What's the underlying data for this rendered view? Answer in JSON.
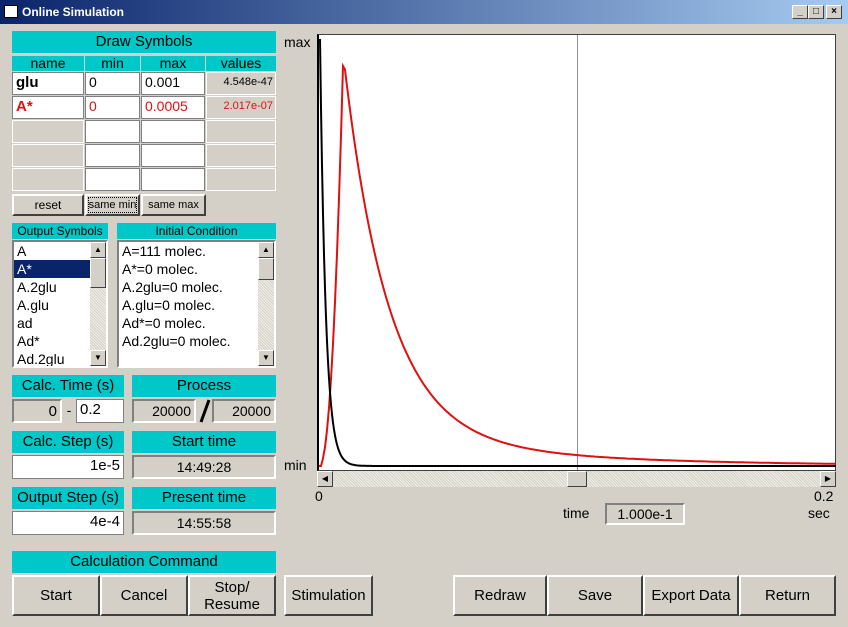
{
  "window": {
    "title": "Online Simulation",
    "buttons": [
      "_",
      "□",
      "×"
    ]
  },
  "draw_symbols": {
    "header": "Draw Symbols",
    "columns": [
      "name",
      "min",
      "max",
      "values"
    ],
    "rows": [
      {
        "name": "glu",
        "min": "0",
        "max": "0.001",
        "value": "4.548e-47",
        "color": "#000000"
      },
      {
        "name": "A*",
        "min": "0",
        "max": "0.0005",
        "value": "2.017e-07",
        "color": "#dd1111"
      },
      {
        "name": "",
        "min": "",
        "max": "",
        "value": ""
      },
      {
        "name": "",
        "min": "",
        "max": "",
        "value": ""
      },
      {
        "name": "",
        "min": "",
        "max": "",
        "value": ""
      }
    ],
    "reset": "reset",
    "same_min": "same min",
    "same_max": "same max"
  },
  "output_symbols": {
    "header": "Output Symbols",
    "items": [
      "A",
      "A*",
      "A.2glu",
      "A.glu",
      "ad",
      "Ad*",
      "Ad.2glu"
    ],
    "selected_index": 1
  },
  "initial_condition": {
    "header": "Initial Condition",
    "items": [
      "A=111 molec.",
      "A*=0 molec.",
      "A.2glu=0 molec.",
      "A.glu=0 molec.",
      "Ad*=0 molec.",
      "Ad.2glu=0 molec."
    ]
  },
  "calc_time": {
    "label": "Calc. Time (s)",
    "from": "0",
    "sep": "-",
    "to": "0.2"
  },
  "process": {
    "label": "Process",
    "current": "20000",
    "total": "20000"
  },
  "calc_step": {
    "label": "Calc. Step (s)",
    "value": "1e-5"
  },
  "start_time": {
    "label": "Start time",
    "value": "14:49:28"
  },
  "output_step": {
    "label": "Output Step (s)",
    "value": "4e-4"
  },
  "present_time": {
    "label": "Present time",
    "value": "14:55:58"
  },
  "calc_command": {
    "label": "Calculation Command",
    "start": "Start",
    "cancel": "Cancel",
    "stop_resume_1": "Stop/",
    "stop_resume_2": "Resume"
  },
  "buttons": {
    "stimulation": "Stimulation",
    "redraw": "Redraw",
    "save": "Save",
    "export": "Export Data",
    "return": "Return"
  },
  "plot": {
    "y_max_label": "max",
    "y_min_label": "min",
    "x_start": "0",
    "x_end": "0.2",
    "x_unit": "sec",
    "time_label": "time",
    "time_value": "1.000e-1",
    "cursor_fraction": 0.5,
    "colors": {
      "glu": "#000000",
      "A_star": "#dd1111"
    }
  }
}
